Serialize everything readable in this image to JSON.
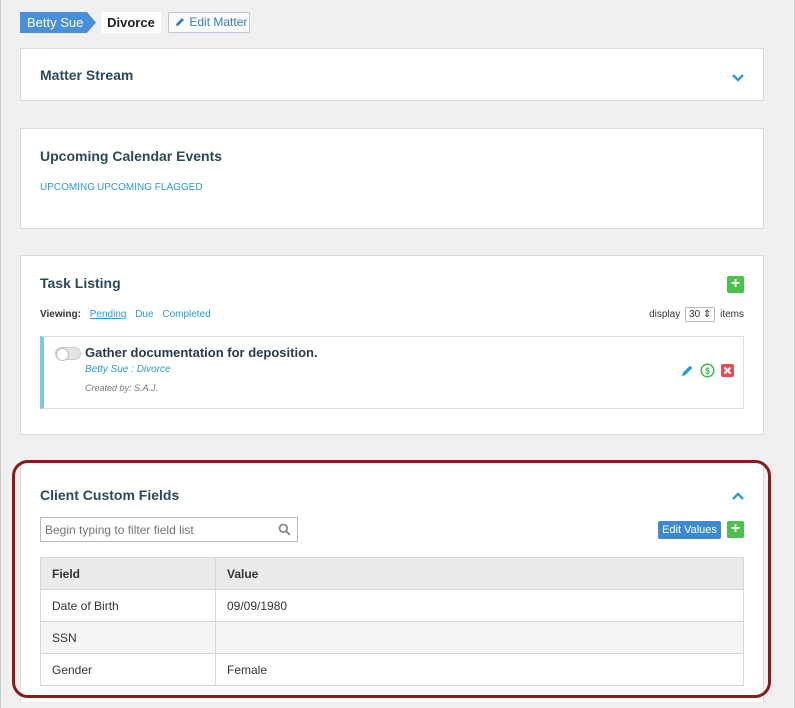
{
  "breadcrumb": {
    "client": "Betty Sue",
    "matter": "Divorce",
    "edit_label": "Edit Matter"
  },
  "matter_stream": {
    "title": "Matter Stream"
  },
  "calendar": {
    "title": "Upcoming Calendar Events",
    "tabs": [
      "UPCOMING",
      "UPCOMING FLAGGED"
    ]
  },
  "tasks": {
    "title": "Task Listing",
    "viewing_label": "Viewing:",
    "filters": [
      "Pending",
      "Due",
      "Completed"
    ],
    "active_filter": "Pending",
    "display_label": "display",
    "display_count": "30",
    "items_label": "items",
    "items": [
      {
        "title": "Gather documentation for deposition.",
        "subtitle": "Betty Sue : Divorce",
        "created": "Created by: S.A.J."
      }
    ]
  },
  "custom_fields": {
    "title": "Client Custom Fields",
    "filter_placeholder": "Begin typing to filter field list",
    "edit_values_label": "Edit Values",
    "columns": [
      "Field",
      "Value"
    ],
    "rows": [
      {
        "field": "Date of Birth",
        "value": "09/09/1980"
      },
      {
        "field": "SSN",
        "value": ""
      },
      {
        "field": "Gender",
        "value": "Female"
      }
    ]
  },
  "colors": {
    "accent": "#2b9ad6",
    "primary_button": "#3d8ad1",
    "add_button": "#4cc14c",
    "highlight": "#8b1a1a"
  },
  "icons": [
    "pencil-icon",
    "chevron-down-icon",
    "chevron-up-icon",
    "plus-icon",
    "dollar-icon",
    "delete-icon",
    "search-icon"
  ]
}
